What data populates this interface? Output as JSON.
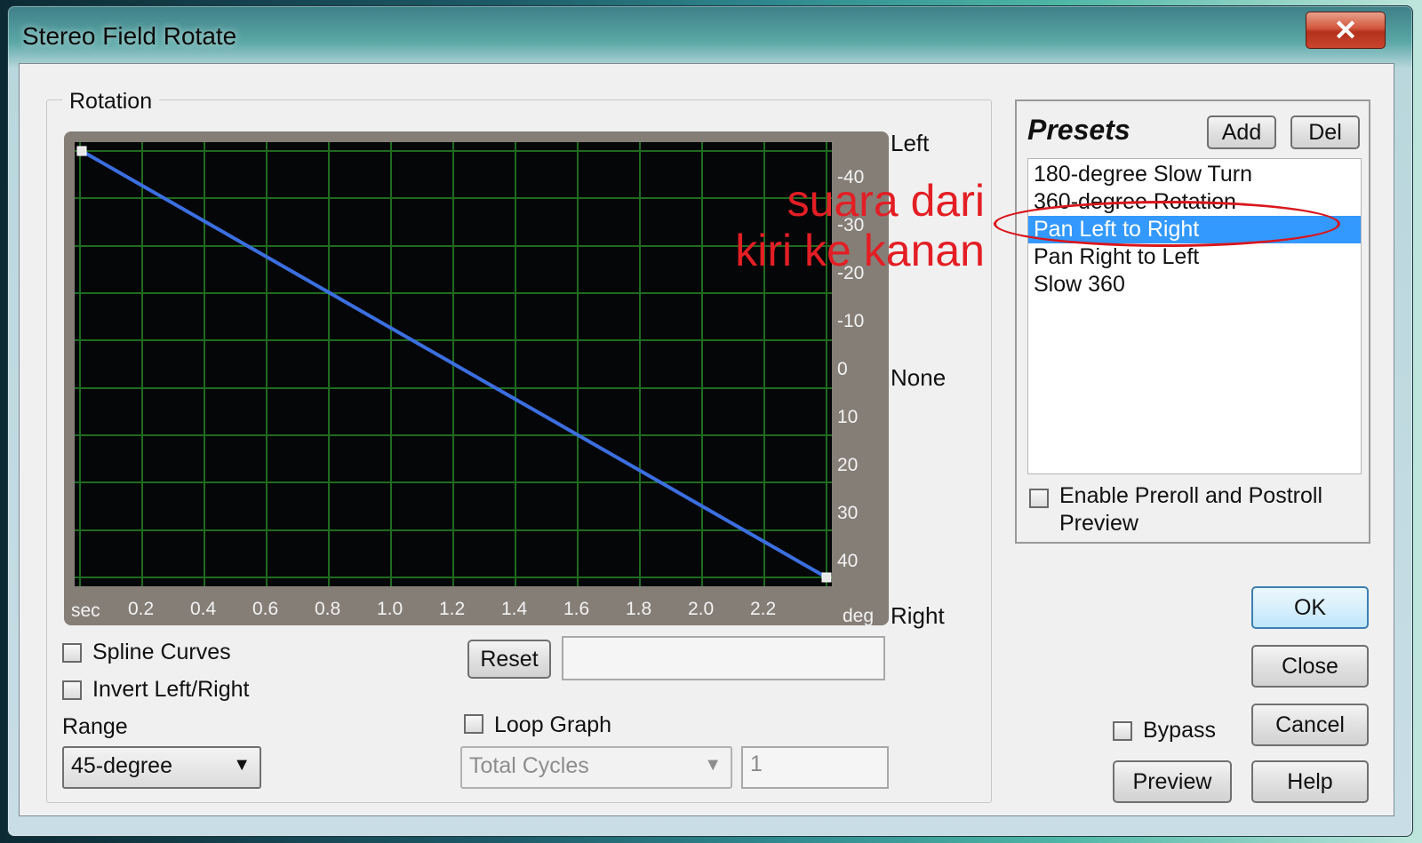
{
  "window": {
    "title": "Stereo Field Rotate",
    "close_glyph": "✕"
  },
  "rotation": {
    "group_label": "Rotation",
    "side_labels": {
      "left": "Left",
      "none": "None",
      "right": "Right"
    },
    "x_axis": {
      "unit_start": "sec",
      "unit_end": "deg",
      "ticks": [
        "0.2",
        "0.4",
        "0.6",
        "0.8",
        "1.0",
        "1.2",
        "1.4",
        "1.6",
        "1.8",
        "2.0",
        "2.2"
      ]
    },
    "y_axis": {
      "ticks": [
        "-40",
        "-30",
        "-20",
        "-10",
        "0",
        "10",
        "20",
        "30",
        "40"
      ]
    },
    "curve": {
      "start_deg": -45,
      "end_deg": 45,
      "color": "#3b6fe0"
    }
  },
  "options": {
    "spline_label": "Spline Curves",
    "invert_label": "Invert Left/Right",
    "range_label": "Range",
    "range_value": "45-degree",
    "reset_label": "Reset",
    "loop_label": "Loop Graph",
    "cycles_select": "Total Cycles",
    "cycles_value": "1"
  },
  "presets": {
    "title": "Presets",
    "add_label": "Add",
    "del_label": "Del",
    "items": [
      "180-degree Slow Turn",
      "360-degree Rotation",
      "Pan Left to Right",
      "Pan Right to Left",
      "Slow 360"
    ],
    "selected_index": 2,
    "preroll_label_1": "Enable Preroll and Postroll",
    "preroll_label_2": "Preview"
  },
  "annotation": {
    "line1": "suara dari",
    "line2": "kiri ke kanan"
  },
  "buttons": {
    "ok": "OK",
    "close": "Close",
    "cancel": "Cancel",
    "help": "Help",
    "preview": "Preview",
    "bypass_label": "Bypass"
  }
}
